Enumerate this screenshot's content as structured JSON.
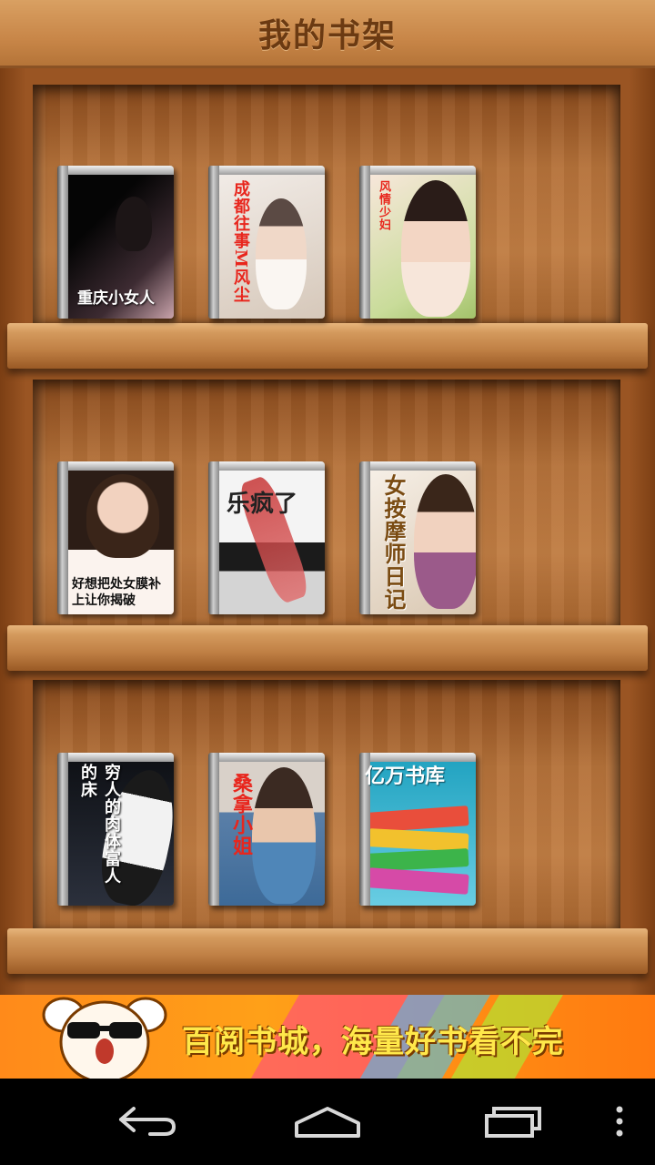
{
  "header": {
    "title": "我的书架"
  },
  "shelves": [
    {
      "books": [
        {
          "title": "重庆小女人",
          "colors": [
            "#0d0d0d",
            "#3a2a2e"
          ]
        },
        {
          "title": "成都往事M风尘",
          "colors": [
            "#e9e2dc",
            "#c9b8a8"
          ]
        },
        {
          "title": "风情少妇",
          "colors": [
            "#f4d8c6",
            "#a8c57a"
          ]
        }
      ]
    },
    {
      "books": [
        {
          "title": "好想把处女膜补上让你揭破",
          "colors": [
            "#2a1c16",
            "#f4e1d4"
          ]
        },
        {
          "title": "乐疯了",
          "colors": [
            "#f0f0f0",
            "#bcbcbc"
          ]
        },
        {
          "title": "女按摩师日记",
          "colors": [
            "#f3ede4",
            "#cfc2b0"
          ]
        }
      ]
    },
    {
      "books": [
        {
          "title": "穷人的肉体富人的床",
          "colors": [
            "#111318",
            "#2d3240"
          ]
        },
        {
          "title": "桑拿小姐",
          "colors": [
            "#d8d0c8",
            "#3f6fa5"
          ]
        },
        {
          "title": "亿万书库",
          "colors": [
            "#1e9ab8",
            "#58c8e0"
          ]
        }
      ]
    }
  ],
  "ad": {
    "slogan": "百阅书城，海量好书看不完"
  },
  "navbar": {
    "back": "back",
    "home": "home",
    "recents": "recents",
    "menu": "menu"
  },
  "colors": {
    "wood": "#c07d43",
    "accent": "#ff8a1a",
    "ad_text": "#ffe84a"
  }
}
